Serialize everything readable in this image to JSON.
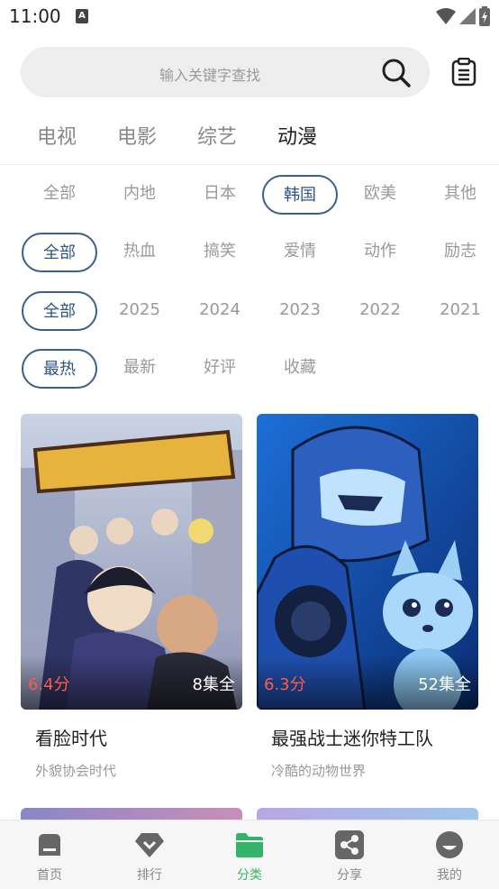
{
  "status_bar": {
    "time": "11:00",
    "notif": "A"
  },
  "search": {
    "placeholder": "输入关键字查找"
  },
  "main_tabs": [
    {
      "label": "电视"
    },
    {
      "label": "电影"
    },
    {
      "label": "综艺"
    },
    {
      "label": "动漫",
      "active": true
    }
  ],
  "filters": {
    "region": [
      "全部",
      "内地",
      "日本",
      "韩国",
      "欧美",
      "其他"
    ],
    "region_selected": "韩国",
    "genre": [
      "全部",
      "热血",
      "搞笑",
      "爱情",
      "动作",
      "励志"
    ],
    "genre_selected": "全部",
    "year": [
      "全部",
      "2025",
      "2024",
      "2023",
      "2022",
      "2021"
    ],
    "year_selected": "全部",
    "sort": [
      "最热",
      "最新",
      "好评",
      "收藏"
    ],
    "sort_selected": "最热"
  },
  "cards": [
    {
      "title": "看脸时代",
      "subtitle": "外貌协会时代",
      "score": "6.4分",
      "episodes": "8集全"
    },
    {
      "title": "最强战士迷你特工队",
      "subtitle": "冷酷的动物世界",
      "score": "6.3分",
      "episodes": "52集全"
    }
  ],
  "bottom_nav": [
    {
      "label": "首页"
    },
    {
      "label": "排行"
    },
    {
      "label": "分类",
      "active": true
    },
    {
      "label": "分享"
    },
    {
      "label": "我的"
    }
  ],
  "colors": {
    "accent": "#3b5f8c",
    "score": "#ff5a4e",
    "nav_active": "#34b46a"
  }
}
